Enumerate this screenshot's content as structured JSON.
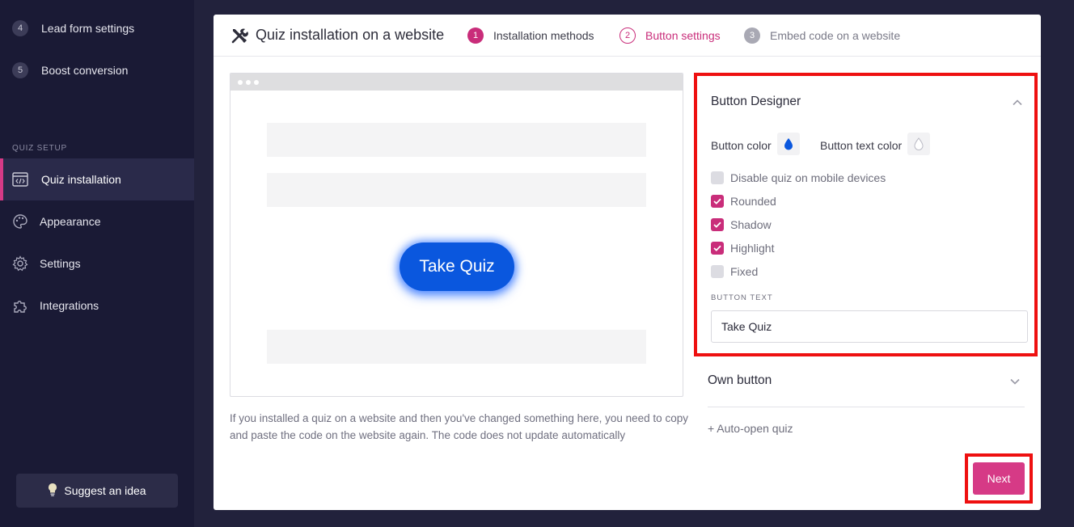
{
  "sidebar": {
    "steps": [
      {
        "num": "4",
        "label": "Lead form settings"
      },
      {
        "num": "5",
        "label": "Boost conversion"
      }
    ],
    "section_title": "QUIZ SETUP",
    "nav": [
      {
        "label": "Quiz installation",
        "icon": "code-window-icon",
        "active": true
      },
      {
        "label": "Appearance",
        "icon": "palette-icon",
        "active": false
      },
      {
        "label": "Settings",
        "icon": "gear-icon",
        "active": false
      },
      {
        "label": "Integrations",
        "icon": "puzzle-icon",
        "active": false
      }
    ],
    "suggest_label": "Suggest an idea"
  },
  "header": {
    "title": "Quiz installation on a website",
    "steps": [
      {
        "num": "1",
        "label": "Installation methods",
        "state": "done"
      },
      {
        "num": "2",
        "label": "Button settings",
        "state": "current"
      },
      {
        "num": "3",
        "label": "Embed code on a website",
        "state": "upcoming"
      }
    ]
  },
  "preview": {
    "button_label": "Take Quiz",
    "hint": "If you installed a quiz on a website and then you've changed something here, you need to copy and paste the code on the website again. The code does not update automatically"
  },
  "designer": {
    "title": "Button Designer",
    "button_color_label": "Button color",
    "button_color": "#0a57de",
    "button_text_color_label": "Button text color",
    "button_text_color": "#ffffff",
    "options": [
      {
        "label": "Disable quiz on mobile devices",
        "checked": false
      },
      {
        "label": "Rounded",
        "checked": true
      },
      {
        "label": "Shadow",
        "checked": true
      },
      {
        "label": "Highlight",
        "checked": true
      },
      {
        "label": "Fixed",
        "checked": false
      }
    ],
    "button_text_label": "BUTTON TEXT",
    "button_text_value": "Take Quiz"
  },
  "own_button_label": "Own button",
  "auto_open_label": "+ Auto-open quiz",
  "next_label": "Next",
  "colors": {
    "accent": "#c92d7a",
    "sidebar_bg": "#1a1a35",
    "highlight_border": "#ee1010"
  }
}
